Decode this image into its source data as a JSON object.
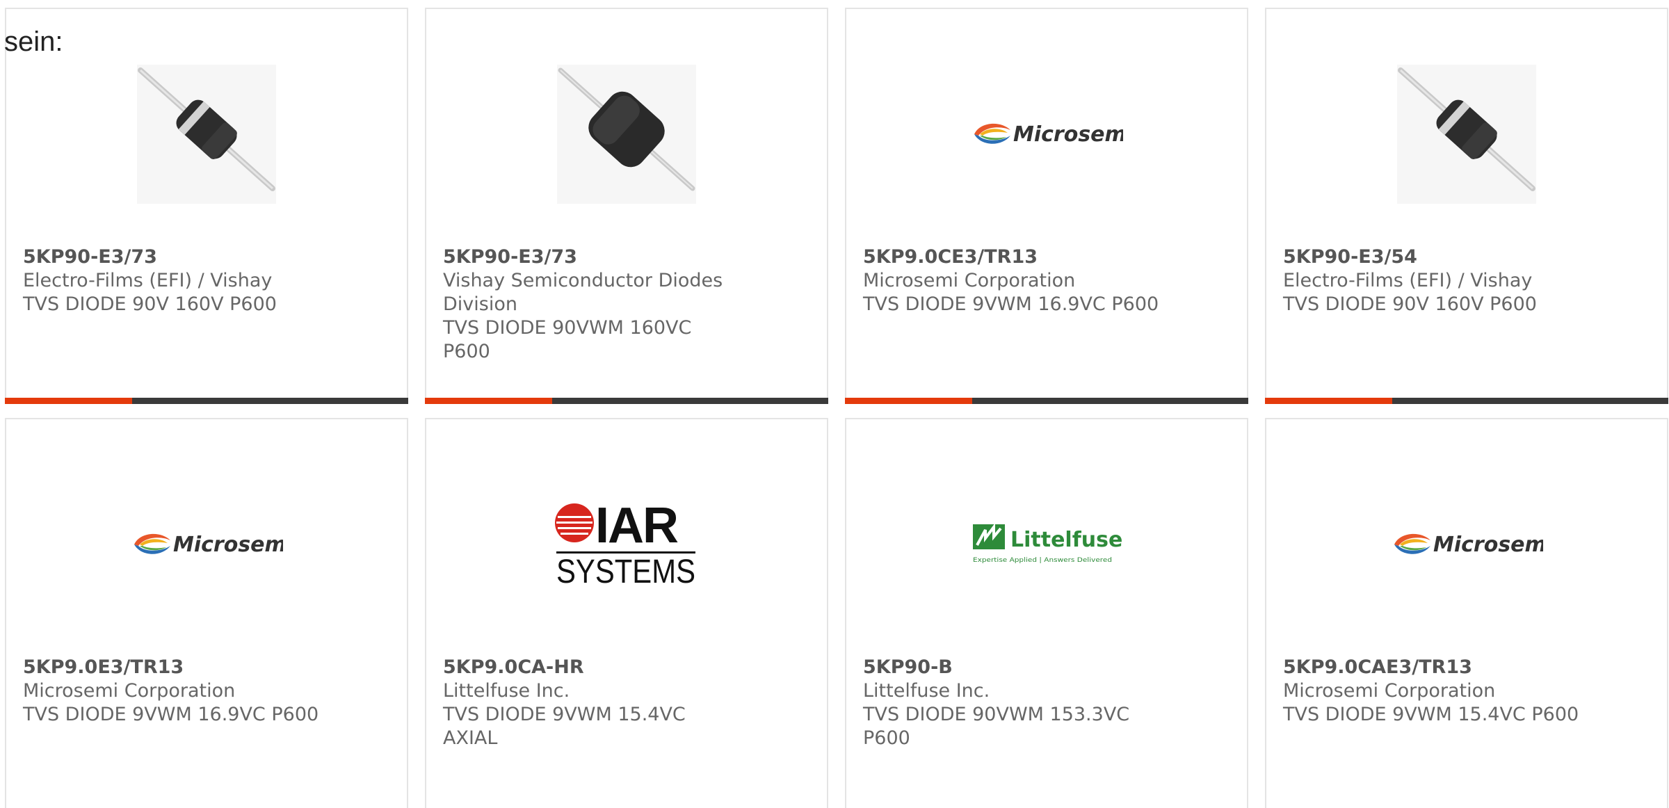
{
  "intro_text": "sein:",
  "colors": {
    "accent": "#e43a0c",
    "bar_dark": "#3a3a3a",
    "card_border": "#e4e4e4",
    "microsemi_text": "#333333",
    "littelfuse_green": "#2e8b3a",
    "iar_red": "#d7261e"
  },
  "products": [
    {
      "part": "5KP90-E3/73",
      "manufacturer": "Electro-Films (EFI) / Vishay",
      "description": "TVS DIODE 90V 160V P600",
      "image_type": "diode-thin-icon"
    },
    {
      "part": "5KP90-E3/73",
      "manufacturer": "Vishay Semiconductor Diodes Division",
      "description": "TVS DIODE 90VWM 160VC P600",
      "image_type": "diode-large-icon"
    },
    {
      "part": "5KP9.0CE3/TR13",
      "manufacturer": "Microsemi Corporation",
      "description": "TVS DIODE 9VWM 16.9VC P600",
      "image_type": "microsemi-logo",
      "logo_text": "Microsemi"
    },
    {
      "part": "5KP90-E3/54",
      "manufacturer": "Electro-Films (EFI) / Vishay",
      "description": "TVS DIODE 90V 160V P600",
      "image_type": "diode-thin-icon"
    },
    {
      "part": "5KP9.0E3/TR13",
      "manufacturer": "Microsemi Corporation",
      "description": "TVS DIODE 9VWM 16.9VC P600",
      "image_type": "microsemi-logo",
      "logo_text": "Microsemi"
    },
    {
      "part": "5KP9.0CA-HR",
      "manufacturer": "Littelfuse Inc.",
      "description": "TVS DIODE 9VWM 15.4VC AXIAL",
      "image_type": "iar-systems-logo",
      "logo_text": "IAR",
      "logo_subtext": "SYSTEMS"
    },
    {
      "part": "5KP90-B",
      "manufacturer": "Littelfuse Inc.",
      "description": "TVS DIODE 90VWM 153.3VC P600",
      "image_type": "littelfuse-logo",
      "logo_text": "Littelfuse",
      "logo_tagline": "Expertise Applied | Answers Delivered"
    },
    {
      "part": "5KP9.0CAE3/TR13",
      "manufacturer": "Microsemi Corporation",
      "description": "TVS DIODE 9VWM 15.4VC P600",
      "image_type": "microsemi-logo",
      "logo_text": "Microsemi"
    }
  ]
}
